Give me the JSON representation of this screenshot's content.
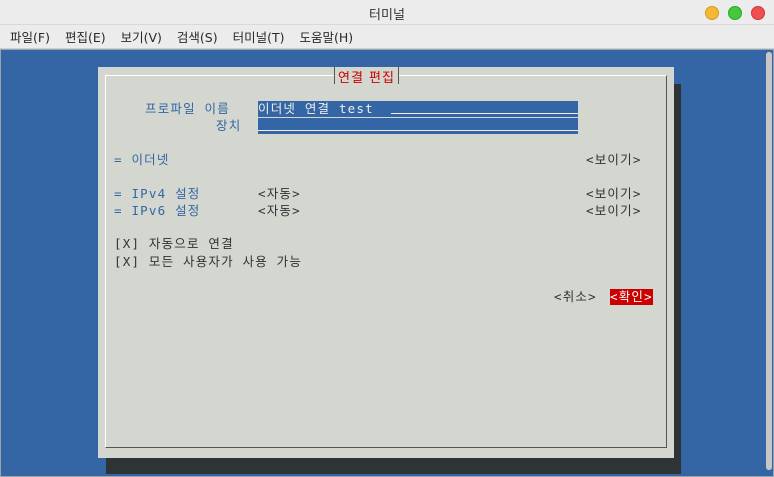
{
  "window": {
    "title": "터미널"
  },
  "menu": {
    "items": [
      "파일(F)",
      "편집(E)",
      "보기(V)",
      "검색(S)",
      "터미널(T)",
      "도움말(H)"
    ]
  },
  "dialog": {
    "title": "연결 편집",
    "profile_label": "프로파일 이름",
    "profile_value": "이더넷 연결 test",
    "device_label": "장치",
    "device_value": "",
    "ethernet_section": "= 이더넷",
    "ethernet_show": "<보이기>",
    "ipv4_label": "= IPv4 설정",
    "ipv4_value": "<자동>",
    "ipv4_show": "<보이기>",
    "ipv6_label": "= IPv6 설정",
    "ipv6_value": "<자동>",
    "ipv6_show": "<보이기>",
    "auto_connect": "[X] 자동으로 연결",
    "all_users": "[X] 모든 사용자가 사용 가능",
    "cancel": "<취소>",
    "ok": "<확인>"
  },
  "colors": {
    "terminal_bg": "#3465a4",
    "dialog_bg": "#d3d7cf",
    "accent_red": "#cc0000",
    "label_blue": "#3465a4"
  }
}
